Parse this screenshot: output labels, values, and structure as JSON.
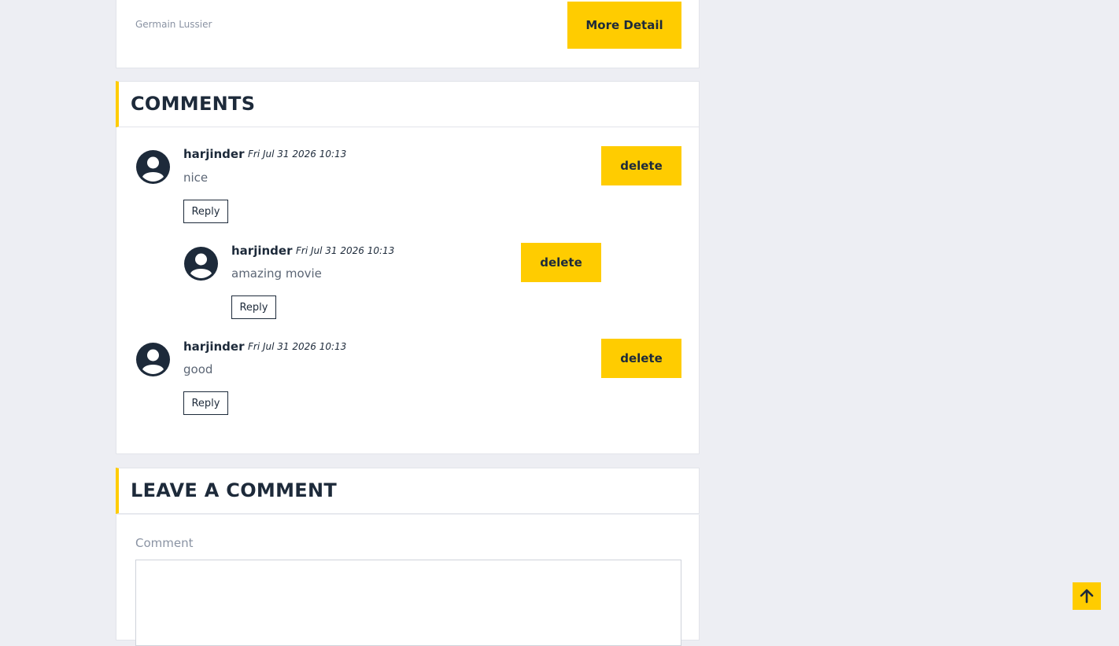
{
  "post": {
    "author": "Germain Lussier",
    "more_detail_label": "More Detail"
  },
  "comments_section": {
    "title": "COMMENTS",
    "items": [
      {
        "name": "harjinder",
        "date": "Fri Jul 31 2026 10:13",
        "text": "nice",
        "reply_label": "Reply",
        "delete_label": "delete"
      },
      {
        "name": "harjinder",
        "date": "Fri Jul 31 2026 10:13",
        "text": "amazing movie",
        "reply_label": "Reply",
        "delete_label": "delete"
      },
      {
        "name": "harjinder",
        "date": "Fri Jul 31 2026 10:13",
        "text": "good",
        "reply_label": "Reply",
        "delete_label": "delete"
      }
    ]
  },
  "leave_comment": {
    "title": "LEAVE A COMMENT",
    "field_label": "Comment"
  },
  "scroll_top": {
    "icon": "arrow-up-icon"
  },
  "colors": {
    "accent": "#ffcc00",
    "text": "#1d2a3a",
    "background": "#edeef3"
  }
}
